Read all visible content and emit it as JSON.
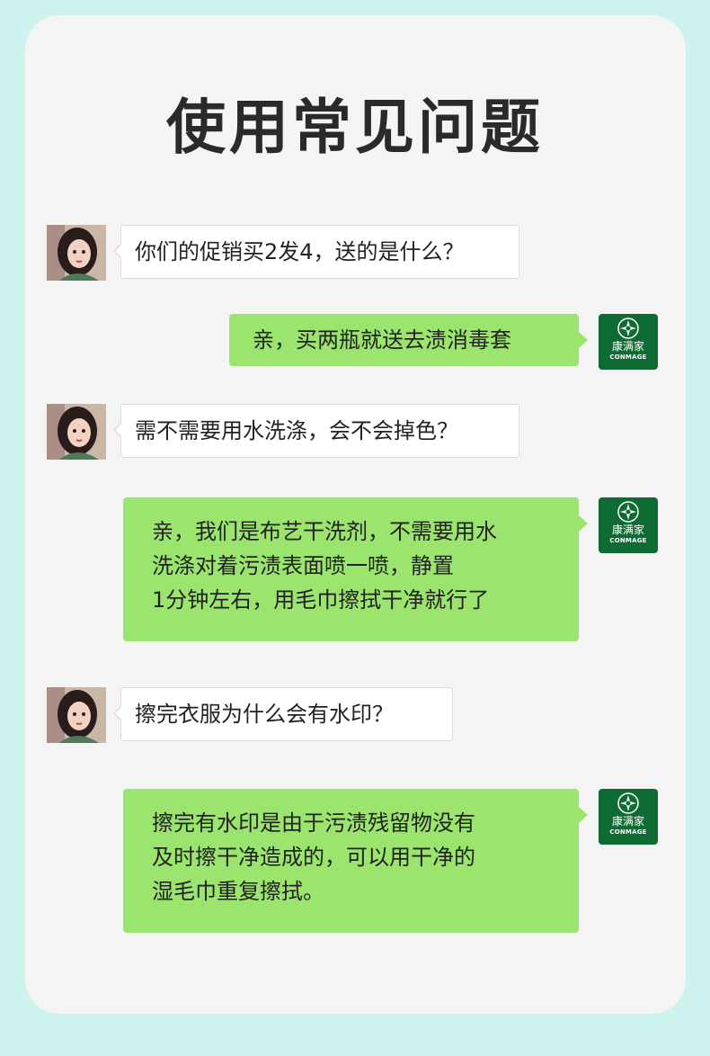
{
  "page": {
    "title": "使用常见问题"
  },
  "logo": {
    "brand_cn": "康满家",
    "brand_en": "CONMAGE",
    "color": "#0f6b34"
  },
  "colors": {
    "answer_bubble": "#9be46d",
    "question_bubble": "#ffffff",
    "background": "#cdf3ef"
  },
  "messages": [
    {
      "role": "customer",
      "lines": [
        "你们的促销买2发4，送的是什么？"
      ]
    },
    {
      "role": "store",
      "lines": [
        "亲，买两瓶就送去渍消毒套"
      ]
    },
    {
      "role": "customer",
      "lines": [
        "需不需要用水洗涤，会不会掉色？"
      ]
    },
    {
      "role": "store",
      "lines": [
        "亲，我们是布艺干洗剂，不需要用水",
        "洗涤对着污渍表面喷一喷，静置",
        "1分钟左右，用毛巾擦拭干净就行了"
      ]
    },
    {
      "role": "customer",
      "lines": [
        "擦完衣服为什么会有水印？"
      ]
    },
    {
      "role": "store",
      "lines": [
        "擦完有水印是由于污渍残留物没有",
        "及时擦干净造成的，可以用干净的",
        "湿毛巾重复擦拭。"
      ]
    }
  ]
}
